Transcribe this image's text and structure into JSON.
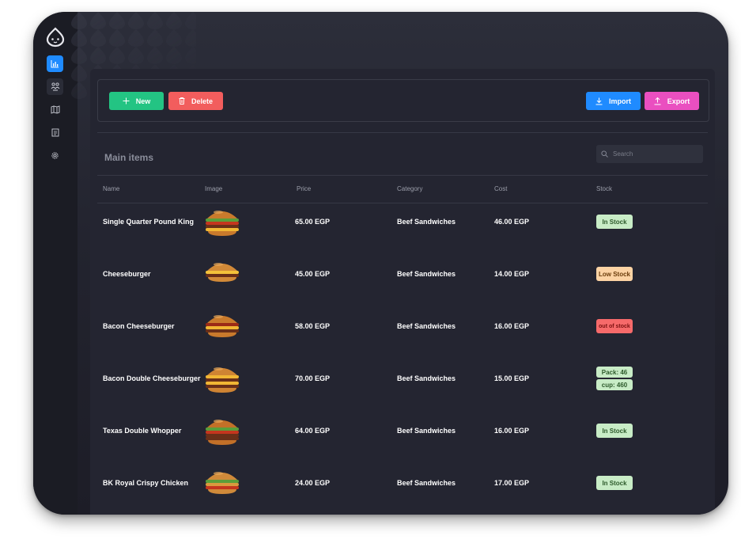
{
  "toolbar": {
    "new_label": "New",
    "delete_label": "Delete",
    "import_label": "Import",
    "export_label": "Export"
  },
  "colors": {
    "new": "#23c483",
    "delete": "#f25d5d",
    "import": "#1f8bff",
    "export": "#ea4fc0",
    "in_stock_bg": "#c8ecc6",
    "low_stock_bg": "#fcd3a4",
    "out_stock_bg": "#f66a6a"
  },
  "sidebar": {
    "items": [
      {
        "icon": "bar-chart-icon"
      },
      {
        "icon": "people-icon"
      },
      {
        "icon": "map-icon"
      },
      {
        "icon": "document-icon"
      },
      {
        "icon": "gear-icon"
      }
    ]
  },
  "section": {
    "title": "Main items",
    "search_placeholder": "Search"
  },
  "table": {
    "headers": [
      "Name",
      "Image",
      "Price",
      "Category",
      "Cost",
      "Stock"
    ],
    "rows": [
      {
        "name": "Single Quarter Pound King",
        "price": "65.00 EGP",
        "category": "Beef Sandwiches",
        "cost": "46.00 EGP",
        "stock": [
          "In Stock"
        ],
        "status": "in"
      },
      {
        "name": "Cheeseburger",
        "price": "45.00 EGP",
        "category": "Beef Sandwiches",
        "cost": "14.00 EGP",
        "stock": [
          "Low Stock"
        ],
        "status": "low"
      },
      {
        "name": "Bacon Cheeseburger",
        "price": "58.00 EGP",
        "category": "Beef Sandwiches",
        "cost": "16.00 EGP",
        "stock": [
          "out of stock"
        ],
        "status": "out"
      },
      {
        "name": "Bacon Double Cheeseburger",
        "price": "70.00 EGP",
        "category": "Beef Sandwiches",
        "cost": "15.00 EGP",
        "stock": [
          "Pack: 46",
          "cup: 460"
        ],
        "status": "in"
      },
      {
        "name": "Texas Double Whopper",
        "price": "64.00 EGP",
        "category": "Beef Sandwiches",
        "cost": "16.00 EGP",
        "stock": [
          "In Stock"
        ],
        "status": "in"
      },
      {
        "name": "BK Royal Crispy Chicken",
        "price": "24.00 EGP",
        "category": "Beef Sandwiches",
        "cost": "17.00 EGP",
        "stock": [
          "In Stock"
        ],
        "status": "in"
      }
    ]
  }
}
